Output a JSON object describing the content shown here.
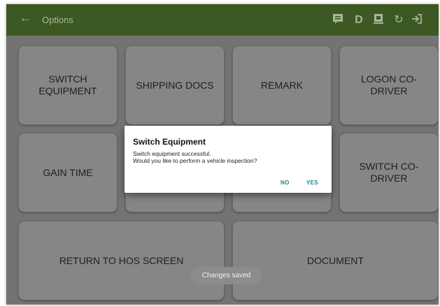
{
  "appbar": {
    "title": "Options",
    "icons": [
      "back-arrow-icon",
      "message-icon",
      "duty-status-d-icon",
      "device-icon",
      "refresh-icon",
      "logout-icon"
    ],
    "d_label": "D",
    "color": "#3c5923"
  },
  "tiles": {
    "switch_equipment": "SWITCH EQUIPMENT",
    "shipping_docs": "SHIPPING DOCS",
    "remark": "REMARK",
    "logon_co_driver": "LOGON CO-DRIVER",
    "gain_time": "GAIN TIME",
    "switch_co_driver": "SWITCH CO-DRIVER",
    "return_to_hos": "RETURN TO HOS SCREEN",
    "document": "DOCUMENT"
  },
  "dialog": {
    "title": "Switch Equipment",
    "message_line1": "Switch equipment successful.",
    "message_line2": "Would you like to perform a vehicle inspection?",
    "no_label": "NO",
    "yes_label": "YES",
    "accent": "#138a8a"
  },
  "toast": {
    "text": "Changes saved"
  }
}
